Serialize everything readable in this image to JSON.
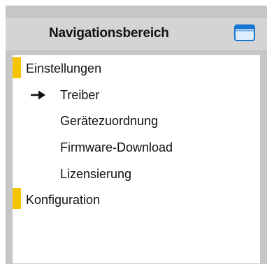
{
  "panel": {
    "title": "Navigationsbereich",
    "window_icon": "window-icon",
    "accent_color": "#f5c400"
  },
  "nav": {
    "items": [
      {
        "label": "Einstellungen",
        "level": 0,
        "marked": true,
        "current": false
      },
      {
        "label": "Treiber",
        "level": 1,
        "marked": false,
        "current": true
      },
      {
        "label": "Gerätezuordnung",
        "level": 1,
        "marked": false,
        "current": false
      },
      {
        "label": "Firmware-Download",
        "level": 1,
        "marked": false,
        "current": false
      },
      {
        "label": "Lizensierung",
        "level": 1,
        "marked": false,
        "current": false
      },
      {
        "label": "Konfiguration",
        "level": 0,
        "marked": true,
        "current": false
      }
    ],
    "current_indicator_icon": "arrow-right-icon"
  }
}
